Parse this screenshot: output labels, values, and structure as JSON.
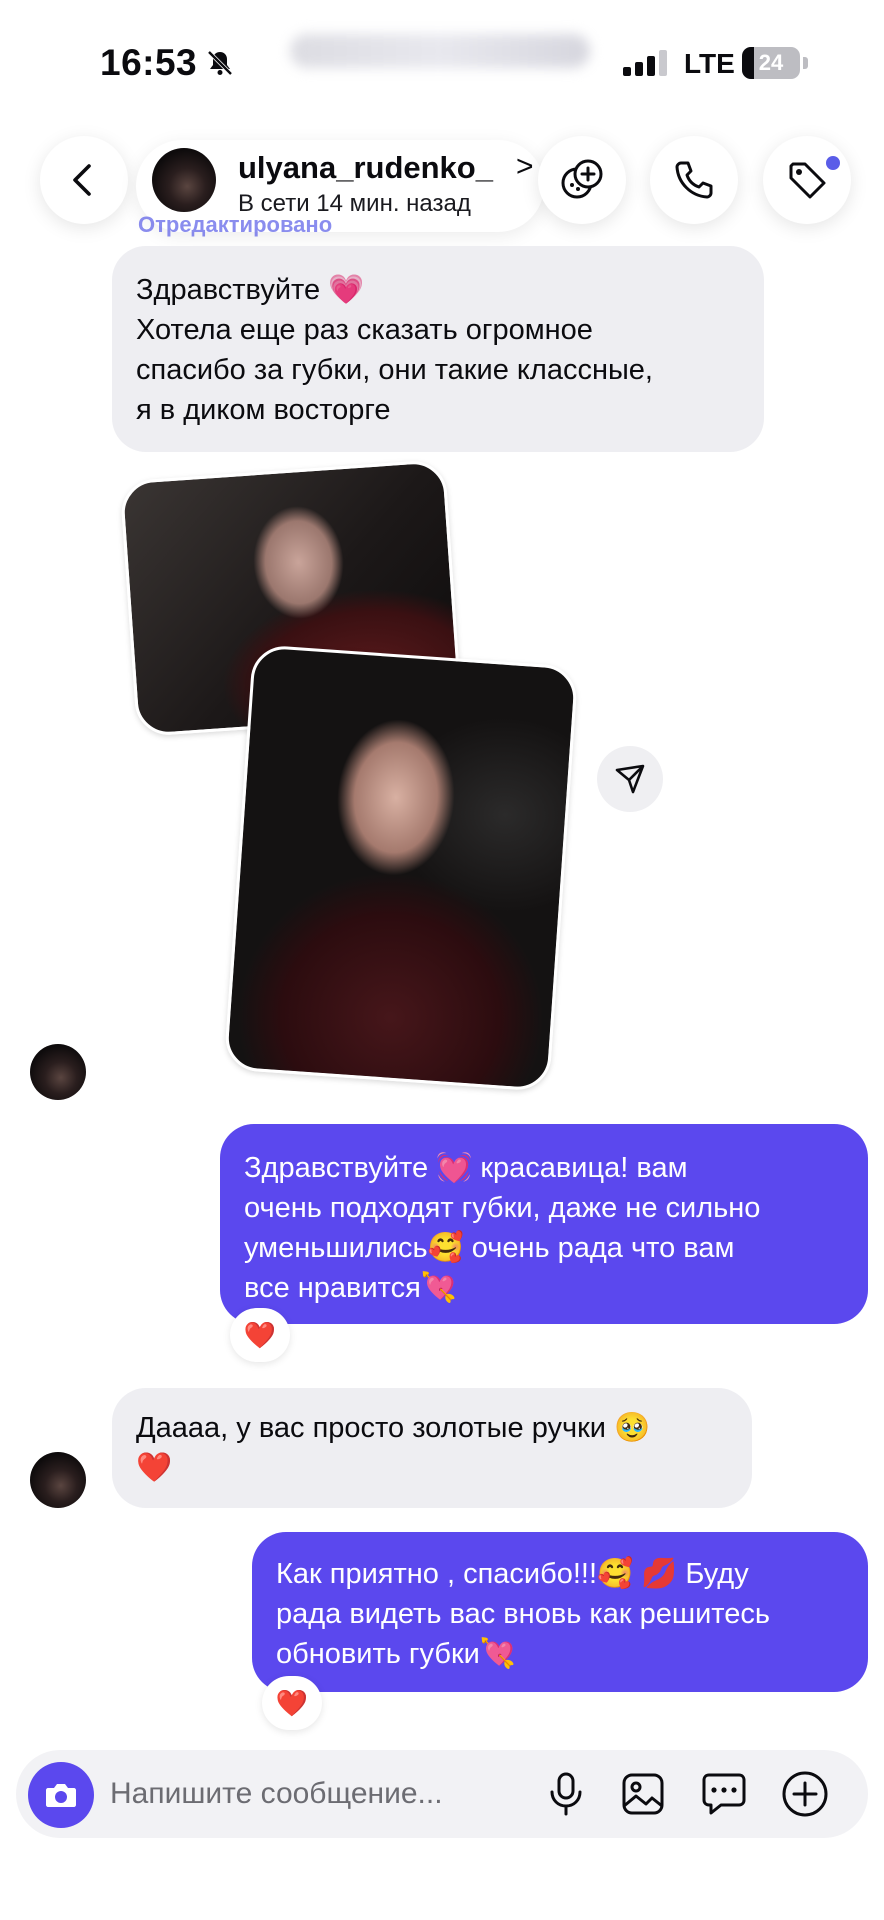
{
  "status_bar": {
    "time": "16:53",
    "network": "LTE",
    "battery": "24"
  },
  "header": {
    "username": "ulyana_rudenko_",
    "chevron": ">",
    "presence": "В сети 14 мин. назад"
  },
  "edited_label": "Отредактировано",
  "messages": [
    {
      "direction": "incoming",
      "lines": [
        "Здравствуйте 💗",
        "Хотела еще раз сказать огромное",
        "спасибо за губки, они такие классные,",
        "я в диком восторге"
      ]
    },
    {
      "direction": "outgoing",
      "lines": [
        "Здравствуйте 💓 красавица! вам",
        "очень подходят губки, даже не сильно",
        "уменьшились🥰 очень рада что вам",
        "все нравится💘"
      ],
      "reaction": "❤️"
    },
    {
      "direction": "incoming",
      "lines": [
        "Даааа, у вас просто золотые ручки 🥹",
        "❤️"
      ]
    },
    {
      "direction": "outgoing",
      "lines": [
        "Как приятно , спасибо!!!🥰 💋 Буду",
        "рада видеть вас вновь как решитесь",
        "обновить губки💘"
      ],
      "reaction": "❤️"
    }
  ],
  "composer": {
    "placeholder": "Напишите сообщение..."
  },
  "colors": {
    "accent": "#5b48ee",
    "incoming_bubble": "#eeeef2",
    "edited_label": "#5a5de8"
  },
  "icons": {
    "header": [
      "back-arrow-icon",
      "sticker-add-icon",
      "phone-icon",
      "tag-icon"
    ],
    "composer": [
      "camera-icon",
      "microphone-icon",
      "gallery-icon",
      "chat-bubble-icon",
      "plus-circle-icon"
    ],
    "other": [
      "mute-bell-icon",
      "signal-icon",
      "share-send-icon"
    ]
  }
}
